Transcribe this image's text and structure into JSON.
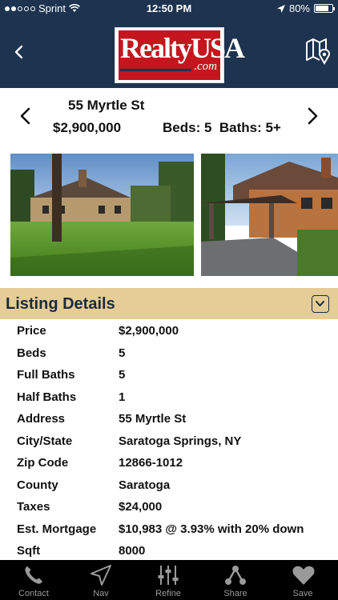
{
  "status_bar": {
    "carrier": "Sprint",
    "time": "12:50 PM",
    "battery": "80%",
    "battery_level": 0.8,
    "signal_bars_filled": 2,
    "signal_bars_total": 5
  },
  "header": {
    "logo_text": "RealtyUSA",
    "logo_suffix": ".com",
    "back_icon": "chevron-left-icon",
    "map_icon": "map-pin-icon",
    "colors": {
      "bar": "#1d3350",
      "logo_red": "#c4161c"
    }
  },
  "listing": {
    "street": "55 Myrtle St",
    "price": "$2,900,000",
    "beds_baths": "Beds: 5  Baths: 5+",
    "prev_icon": "chevron-left-icon",
    "next_icon": "chevron-right-icon"
  },
  "details": {
    "title": "Listing Details",
    "toggle_icon": "chevron-down-icon",
    "bar_color": "#e4cd97",
    "rows": [
      {
        "label": "Price",
        "value": "$2,900,000"
      },
      {
        "label": "Beds",
        "value": "5"
      },
      {
        "label": "Full Baths",
        "value": "5"
      },
      {
        "label": "Half Baths",
        "value": "1"
      },
      {
        "label": "Address",
        "value": "55 Myrtle St"
      },
      {
        "label": "City/State",
        "value": "Saratoga Springs, NY"
      },
      {
        "label": "Zip Code",
        "value": "12866-1012"
      },
      {
        "label": "County",
        "value": "Saratoga"
      },
      {
        "label": "Taxes",
        "value": "$24,000"
      },
      {
        "label": "Est. Mortgage",
        "value": "$10,983 @ 3.93% with 20% down"
      },
      {
        "label": "Sqft",
        "value": "8000"
      }
    ]
  },
  "tabs": [
    {
      "label": "Contact",
      "icon": "phone-icon"
    },
    {
      "label": "Nav",
      "icon": "navigation-icon"
    },
    {
      "label": "Refine",
      "icon": "sliders-icon"
    },
    {
      "label": "Share",
      "icon": "share-icon"
    },
    {
      "label": "Save",
      "icon": "heart-icon"
    }
  ]
}
